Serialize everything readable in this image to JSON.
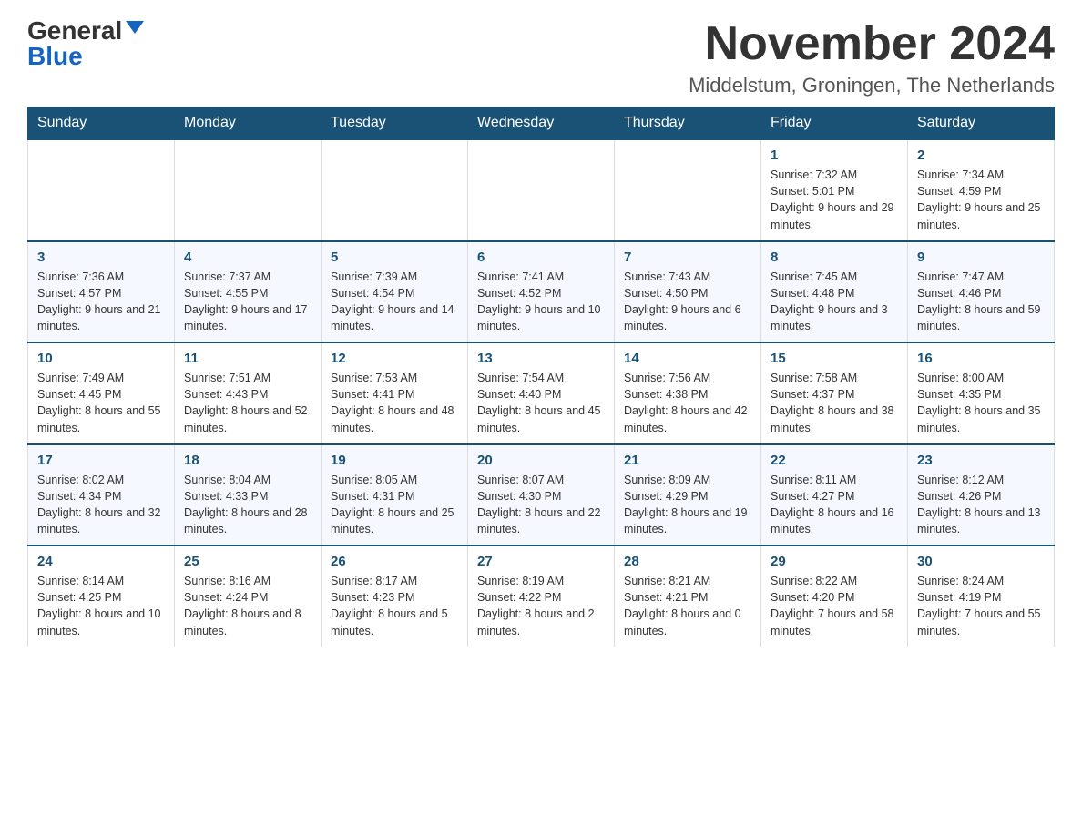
{
  "logo": {
    "general": "General",
    "blue": "Blue"
  },
  "title": "November 2024",
  "location": "Middelstum, Groningen, The Netherlands",
  "days_of_week": [
    "Sunday",
    "Monday",
    "Tuesday",
    "Wednesday",
    "Thursday",
    "Friday",
    "Saturday"
  ],
  "weeks": [
    [
      {
        "day": "",
        "info": ""
      },
      {
        "day": "",
        "info": ""
      },
      {
        "day": "",
        "info": ""
      },
      {
        "day": "",
        "info": ""
      },
      {
        "day": "",
        "info": ""
      },
      {
        "day": "1",
        "info": "Sunrise: 7:32 AM\nSunset: 5:01 PM\nDaylight: 9 hours\nand 29 minutes."
      },
      {
        "day": "2",
        "info": "Sunrise: 7:34 AM\nSunset: 4:59 PM\nDaylight: 9 hours\nand 25 minutes."
      }
    ],
    [
      {
        "day": "3",
        "info": "Sunrise: 7:36 AM\nSunset: 4:57 PM\nDaylight: 9 hours\nand 21 minutes."
      },
      {
        "day": "4",
        "info": "Sunrise: 7:37 AM\nSunset: 4:55 PM\nDaylight: 9 hours\nand 17 minutes."
      },
      {
        "day": "5",
        "info": "Sunrise: 7:39 AM\nSunset: 4:54 PM\nDaylight: 9 hours\nand 14 minutes."
      },
      {
        "day": "6",
        "info": "Sunrise: 7:41 AM\nSunset: 4:52 PM\nDaylight: 9 hours\nand 10 minutes."
      },
      {
        "day": "7",
        "info": "Sunrise: 7:43 AM\nSunset: 4:50 PM\nDaylight: 9 hours\nand 6 minutes."
      },
      {
        "day": "8",
        "info": "Sunrise: 7:45 AM\nSunset: 4:48 PM\nDaylight: 9 hours\nand 3 minutes."
      },
      {
        "day": "9",
        "info": "Sunrise: 7:47 AM\nSunset: 4:46 PM\nDaylight: 8 hours\nand 59 minutes."
      }
    ],
    [
      {
        "day": "10",
        "info": "Sunrise: 7:49 AM\nSunset: 4:45 PM\nDaylight: 8 hours\nand 55 minutes."
      },
      {
        "day": "11",
        "info": "Sunrise: 7:51 AM\nSunset: 4:43 PM\nDaylight: 8 hours\nand 52 minutes."
      },
      {
        "day": "12",
        "info": "Sunrise: 7:53 AM\nSunset: 4:41 PM\nDaylight: 8 hours\nand 48 minutes."
      },
      {
        "day": "13",
        "info": "Sunrise: 7:54 AM\nSunset: 4:40 PM\nDaylight: 8 hours\nand 45 minutes."
      },
      {
        "day": "14",
        "info": "Sunrise: 7:56 AM\nSunset: 4:38 PM\nDaylight: 8 hours\nand 42 minutes."
      },
      {
        "day": "15",
        "info": "Sunrise: 7:58 AM\nSunset: 4:37 PM\nDaylight: 8 hours\nand 38 minutes."
      },
      {
        "day": "16",
        "info": "Sunrise: 8:00 AM\nSunset: 4:35 PM\nDaylight: 8 hours\nand 35 minutes."
      }
    ],
    [
      {
        "day": "17",
        "info": "Sunrise: 8:02 AM\nSunset: 4:34 PM\nDaylight: 8 hours\nand 32 minutes."
      },
      {
        "day": "18",
        "info": "Sunrise: 8:04 AM\nSunset: 4:33 PM\nDaylight: 8 hours\nand 28 minutes."
      },
      {
        "day": "19",
        "info": "Sunrise: 8:05 AM\nSunset: 4:31 PM\nDaylight: 8 hours\nand 25 minutes."
      },
      {
        "day": "20",
        "info": "Sunrise: 8:07 AM\nSunset: 4:30 PM\nDaylight: 8 hours\nand 22 minutes."
      },
      {
        "day": "21",
        "info": "Sunrise: 8:09 AM\nSunset: 4:29 PM\nDaylight: 8 hours\nand 19 minutes."
      },
      {
        "day": "22",
        "info": "Sunrise: 8:11 AM\nSunset: 4:27 PM\nDaylight: 8 hours\nand 16 minutes."
      },
      {
        "day": "23",
        "info": "Sunrise: 8:12 AM\nSunset: 4:26 PM\nDaylight: 8 hours\nand 13 minutes."
      }
    ],
    [
      {
        "day": "24",
        "info": "Sunrise: 8:14 AM\nSunset: 4:25 PM\nDaylight: 8 hours\nand 10 minutes."
      },
      {
        "day": "25",
        "info": "Sunrise: 8:16 AM\nSunset: 4:24 PM\nDaylight: 8 hours\nand 8 minutes."
      },
      {
        "day": "26",
        "info": "Sunrise: 8:17 AM\nSunset: 4:23 PM\nDaylight: 8 hours\nand 5 minutes."
      },
      {
        "day": "27",
        "info": "Sunrise: 8:19 AM\nSunset: 4:22 PM\nDaylight: 8 hours\nand 2 minutes."
      },
      {
        "day": "28",
        "info": "Sunrise: 8:21 AM\nSunset: 4:21 PM\nDaylight: 8 hours\nand 0 minutes."
      },
      {
        "day": "29",
        "info": "Sunrise: 8:22 AM\nSunset: 4:20 PM\nDaylight: 7 hours\nand 58 minutes."
      },
      {
        "day": "30",
        "info": "Sunrise: 8:24 AM\nSunset: 4:19 PM\nDaylight: 7 hours\nand 55 minutes."
      }
    ]
  ],
  "accent_color": "#1a5276"
}
